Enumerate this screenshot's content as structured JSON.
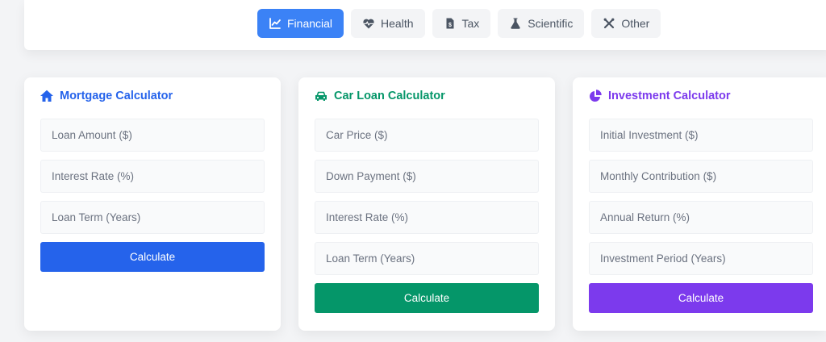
{
  "nav": {
    "tabs": [
      {
        "label": "Financial",
        "icon": "chart-line-icon",
        "active": true
      },
      {
        "label": "Health",
        "icon": "heart-pulse-icon",
        "active": false
      },
      {
        "label": "Tax",
        "icon": "file-invoice-icon",
        "active": false
      },
      {
        "label": "Scientific",
        "icon": "flask-icon",
        "active": false
      },
      {
        "label": "Other",
        "icon": "tools-icon",
        "active": false
      }
    ]
  },
  "colors": {
    "active_tab": "#3b82f6",
    "mortgage": "#2563eb",
    "car_loan": "#059669",
    "investment": "#7c3aed"
  },
  "mortgage": {
    "title": "Mortgage Calculator",
    "icon": "home-icon",
    "fields": [
      {
        "placeholder": "Loan Amount ($)",
        "value": ""
      },
      {
        "placeholder": "Interest Rate (%)",
        "value": ""
      },
      {
        "placeholder": "Loan Term (Years)",
        "value": ""
      }
    ],
    "button": "Calculate"
  },
  "car_loan": {
    "title": "Car Loan Calculator",
    "icon": "car-icon",
    "fields": [
      {
        "placeholder": "Car Price ($)",
        "value": ""
      },
      {
        "placeholder": "Down Payment ($)",
        "value": ""
      },
      {
        "placeholder": "Interest Rate (%)",
        "value": ""
      },
      {
        "placeholder": "Loan Term (Years)",
        "value": ""
      }
    ],
    "button": "Calculate"
  },
  "investment": {
    "title": "Investment Calculator",
    "icon": "pie-chart-icon",
    "fields": [
      {
        "placeholder": "Initial Investment ($)",
        "value": ""
      },
      {
        "placeholder": "Monthly Contribution ($)",
        "value": ""
      },
      {
        "placeholder": "Annual Return (%)",
        "value": ""
      },
      {
        "placeholder": "Investment Period (Years)",
        "value": ""
      }
    ],
    "button": "Calculate"
  }
}
